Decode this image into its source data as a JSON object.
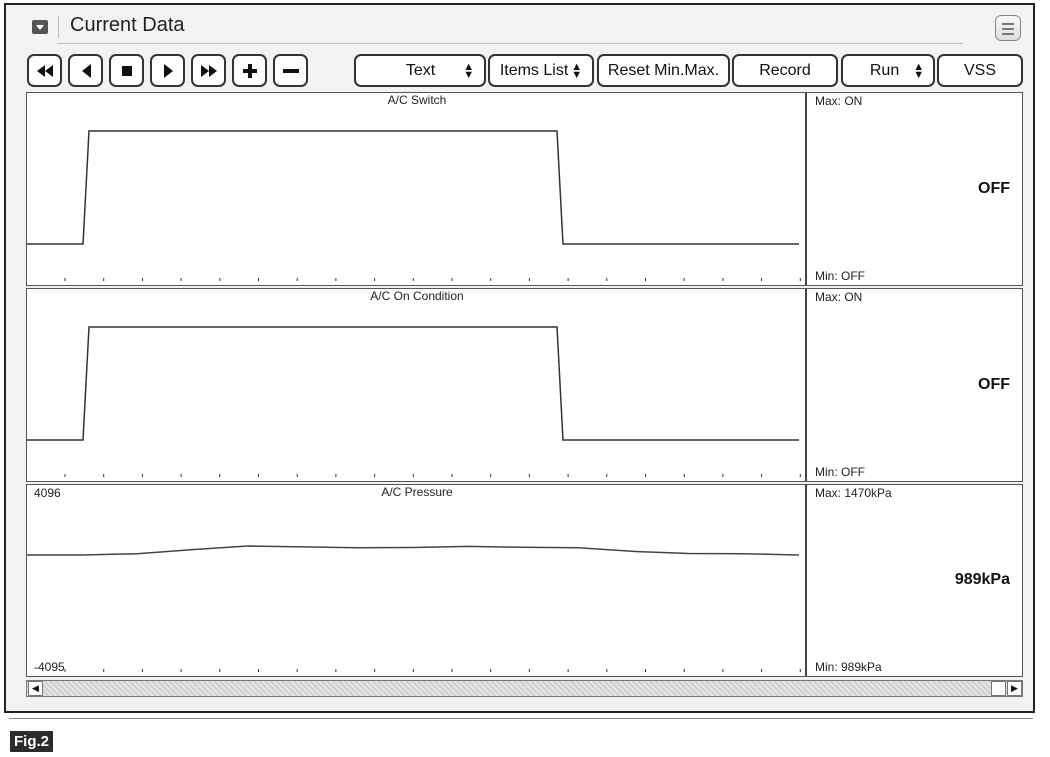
{
  "window": {
    "title": "Current Data"
  },
  "toolbar": {
    "nav_icons": [
      "rewind-icon",
      "step-back-icon",
      "stop-icon",
      "play-icon",
      "fast-forward-icon",
      "zoom-in-icon",
      "zoom-out-icon"
    ],
    "display_select": "Text",
    "items_list_select": "Items List",
    "reset_label": "Reset Min.Max.",
    "record_label": "Record",
    "run_select": "Run",
    "vss_label": "VSS"
  },
  "panels": [
    {
      "title": "A/C Switch",
      "max": "Max: ON",
      "min": "Min:  OFF",
      "value": "OFF"
    },
    {
      "title": "A/C On Condition",
      "max": "Max: ON",
      "min": "Min:  OFF",
      "value": "OFF"
    },
    {
      "title": "A/C Pressure",
      "max": "Max:  1470kPa",
      "min": "Min:    989kPa",
      "value": "989kPa",
      "y_top_label": "4096",
      "y_bottom_label": "-4095"
    }
  ],
  "chart_data": [
    {
      "type": "line",
      "title": "A/C Switch",
      "series": [
        {
          "values_on_off": [
            0,
            0,
            1,
            1,
            1,
            1,
            1,
            1,
            1,
            1,
            1,
            1,
            1,
            1,
            0,
            0,
            0,
            0,
            0,
            0,
            0
          ]
        }
      ]
    },
    {
      "type": "line",
      "title": "A/C On Condition",
      "series": [
        {
          "values_on_off": [
            0,
            0,
            1,
            1,
            1,
            1,
            1,
            1,
            1,
            1,
            1,
            1,
            1,
            1,
            0,
            0,
            0,
            0,
            0,
            0,
            0
          ]
        }
      ]
    },
    {
      "type": "line",
      "title": "A/C Pressure",
      "ylim": [
        -4095,
        4096
      ],
      "series": [
        {
          "values": [
            989,
            989,
            1060,
            1280,
            1470,
            1420,
            1380,
            1390,
            1450,
            1400,
            1380,
            1180,
            1070,
            1060,
            989
          ]
        }
      ]
    }
  ],
  "figure_label": "Fig.2"
}
